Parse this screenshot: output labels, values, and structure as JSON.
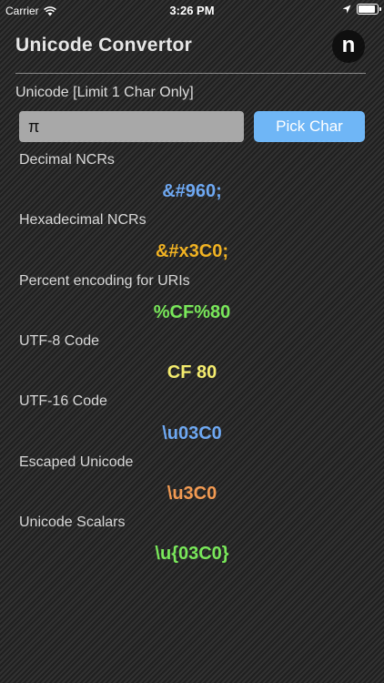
{
  "status_bar": {
    "carrier": "Carrier",
    "time": "3:26 PM",
    "wifi_icon": "wifi-icon",
    "location_icon": "location-arrow-icon",
    "battery_icon": "battery-icon"
  },
  "header": {
    "title": "Unicode Convertor",
    "logo_letter": "n"
  },
  "input": {
    "label": "Unicode [Limit 1 Char Only]",
    "value": "π",
    "button_label": "Pick Char"
  },
  "results": [
    {
      "label": "Decimal NCRs",
      "value": "&#960;",
      "color": "#6ea8f2"
    },
    {
      "label": "Hexadecimal NCRs",
      "value": "&#x3C0;",
      "color": "#f2b322"
    },
    {
      "label": "Percent encoding for URIs",
      "value": "%CF%80",
      "color": "#79e85a"
    },
    {
      "label": "UTF-8 Code",
      "value": "CF 80",
      "color": "#f4ec6e"
    },
    {
      "label": "UTF-16 Code",
      "value": "\\u03C0",
      "color": "#6ea8f2"
    },
    {
      "label": "Escaped Unicode",
      "value": "\\u3C0",
      "color": "#f29a52"
    },
    {
      "label": "Unicode Scalars",
      "value": "\\u{03C0}",
      "color": "#79e85a"
    }
  ]
}
